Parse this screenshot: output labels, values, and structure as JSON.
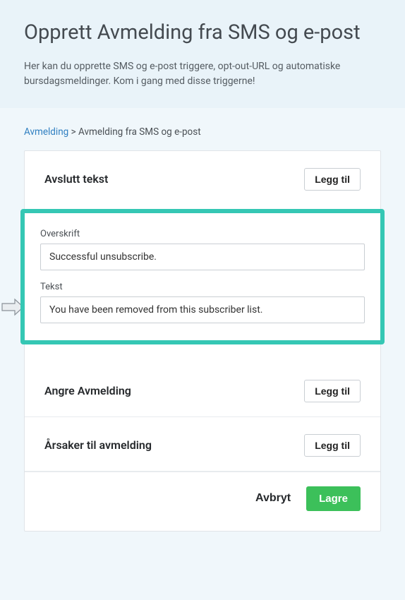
{
  "header": {
    "title": "Opprett Avmelding fra SMS og e-post",
    "description": "Her kan du opprette SMS og e-post triggere, opt-out-URL og automatiske bursdagsmeldinger. Kom i gang med disse triggerne!"
  },
  "breadcrumb": {
    "root": "Avmelding",
    "separator": ">",
    "current": "Avmelding fra SMS og e-post"
  },
  "sections": {
    "avslutt": {
      "title": "Avslutt tekst",
      "add_label": "Legg til",
      "fields": {
        "overskrift_label": "Overskrift",
        "overskrift_value": "Successful unsubscribe.",
        "tekst_label": "Tekst",
        "tekst_value": "You have been removed from this subscriber list."
      }
    },
    "angre": {
      "title": "Angre Avmelding",
      "add_label": "Legg til"
    },
    "arsaker": {
      "title": "Årsaker til avmelding",
      "add_label": "Legg til"
    }
  },
  "footer": {
    "cancel": "Avbryt",
    "save": "Lagre"
  },
  "colors": {
    "highlight_border": "#35c7b4",
    "primary_button": "#3cc05a",
    "link": "#2f7fc1"
  }
}
